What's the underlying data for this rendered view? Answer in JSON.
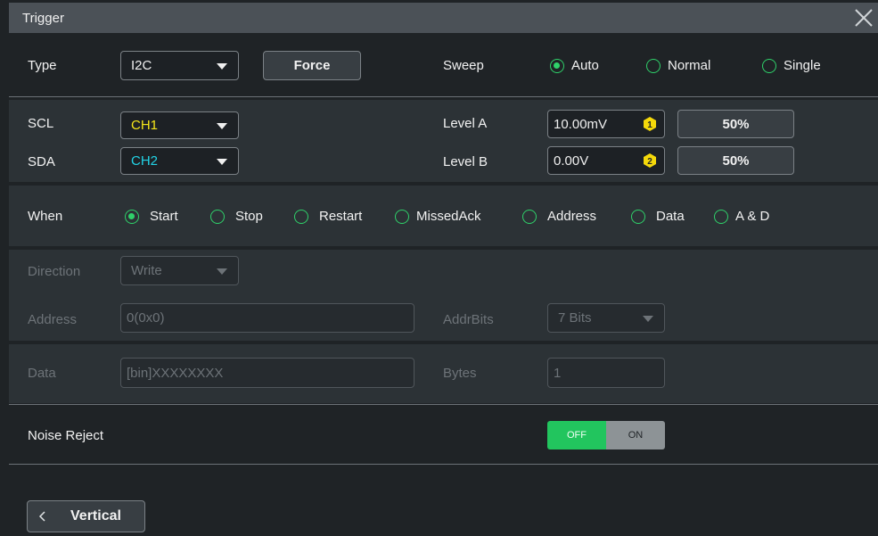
{
  "title": "Trigger",
  "type": {
    "label": "Type",
    "value": "I2C",
    "force_label": "Force"
  },
  "sweep": {
    "label": "Sweep",
    "options": [
      "Auto",
      "Normal",
      "Single"
    ],
    "selected": "Auto"
  },
  "scl": {
    "label": "SCL",
    "value": "CH1",
    "color": "#f5e61a"
  },
  "sda": {
    "label": "SDA",
    "value": "CH2",
    "color": "#22d3e6"
  },
  "level_a": {
    "label": "Level A",
    "value": "10.00mV",
    "pct_label": "50%",
    "badge": "1"
  },
  "level_b": {
    "label": "Level B",
    "value": "0.00V",
    "pct_label": "50%",
    "badge": "2"
  },
  "when": {
    "label": "When",
    "options": [
      "Start",
      "Stop",
      "Restart",
      "MissedAck",
      "Address",
      "Data",
      "A & D"
    ],
    "selected": "Start"
  },
  "direction": {
    "label": "Direction",
    "value": "Write"
  },
  "address": {
    "label": "Address",
    "value": "0(0x0)"
  },
  "addrbits": {
    "label": "AddrBits",
    "value": "7 Bits"
  },
  "data": {
    "label": "Data",
    "value": "[bin]XXXXXXXX"
  },
  "bytes": {
    "label": "Bytes",
    "value": "1"
  },
  "noise": {
    "label": "Noise Reject",
    "off_label": "OFF",
    "on_label": "ON"
  },
  "back": {
    "label": "Vertical"
  },
  "colors": {
    "accent": "#22c55e",
    "badge": "#f5d90a"
  }
}
